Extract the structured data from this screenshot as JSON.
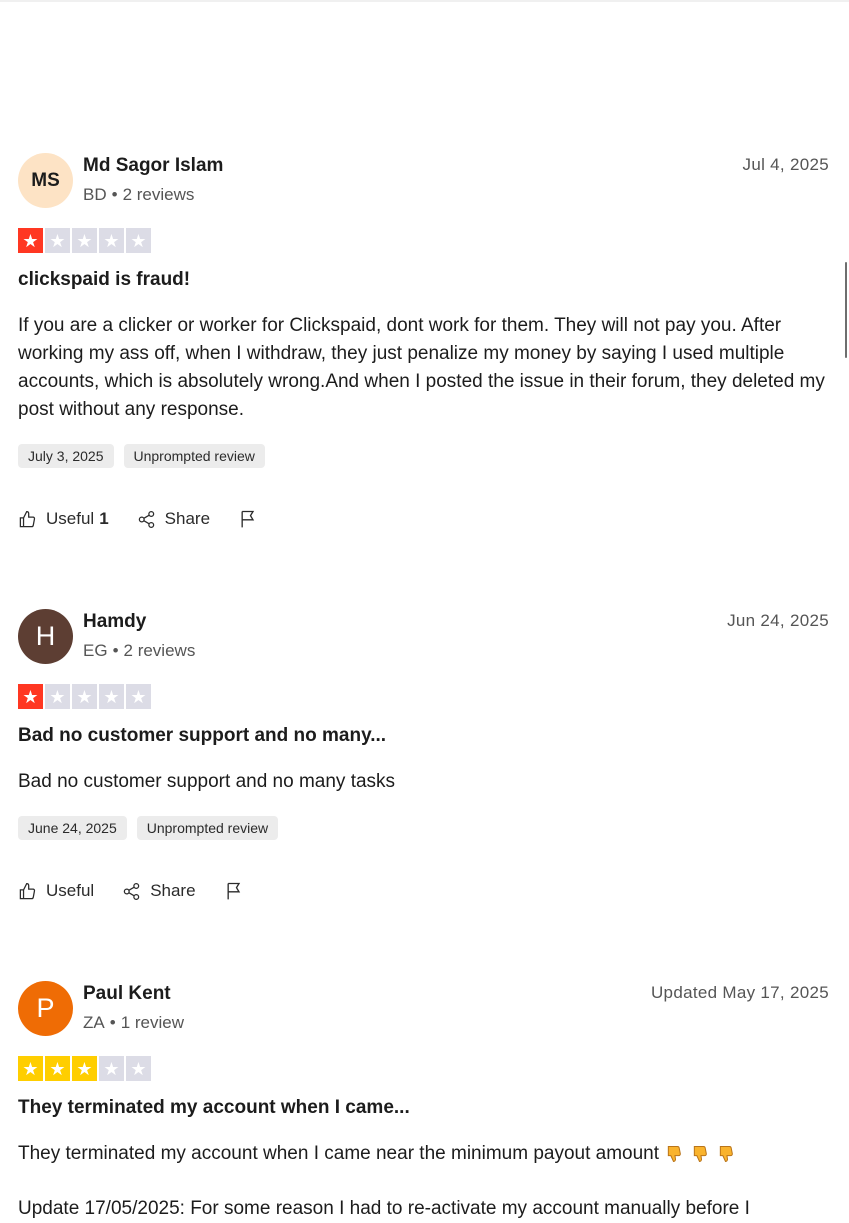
{
  "reviews": [
    {
      "initials": "MS",
      "name": "Md Sagor Islam",
      "country": "BD",
      "review_count": "2 reviews",
      "date": "Jul 4, 2025",
      "rating": 1,
      "title": "clickspaid is fraud!",
      "body": "If you are a clicker or worker for Clickspaid, dont work for them. They will not pay you. After working my ass off, when I withdraw, they just penalize my money by saying I used multiple accounts, which is absolutely wrong.And when I posted the issue in their forum, they deleted my post without any response.",
      "experience_date": "July 3, 2025",
      "tag": "Unprompted review",
      "useful_label": "Useful",
      "useful_count": "1",
      "share_label": "Share"
    },
    {
      "initials": "H",
      "name": "Hamdy",
      "country": "EG",
      "review_count": "2 reviews",
      "date": "Jun 24, 2025",
      "rating": 1,
      "title": "Bad no customer support and no many...",
      "body": "Bad no customer support and no many tasks",
      "experience_date": "June 24, 2025",
      "tag": "Unprompted review",
      "useful_label": "Useful",
      "useful_count": "",
      "share_label": "Share"
    },
    {
      "initials": "P",
      "name": "Paul Kent",
      "country": "ZA",
      "review_count": "1 review",
      "date": "Updated May 17, 2025",
      "rating": 3,
      "title": "They terminated my account when I came...",
      "body": "They terminated my account when I came near the minimum payout amount",
      "body_emoji": "thumbs-down x3",
      "body_line2": "Update 17/05/2025: For some reason I had to re-activate my account manually before I"
    }
  ],
  "colors": {
    "star_red": "#ff3722",
    "star_yellow": "#ffce00",
    "star_empty": "#dcdce6"
  }
}
